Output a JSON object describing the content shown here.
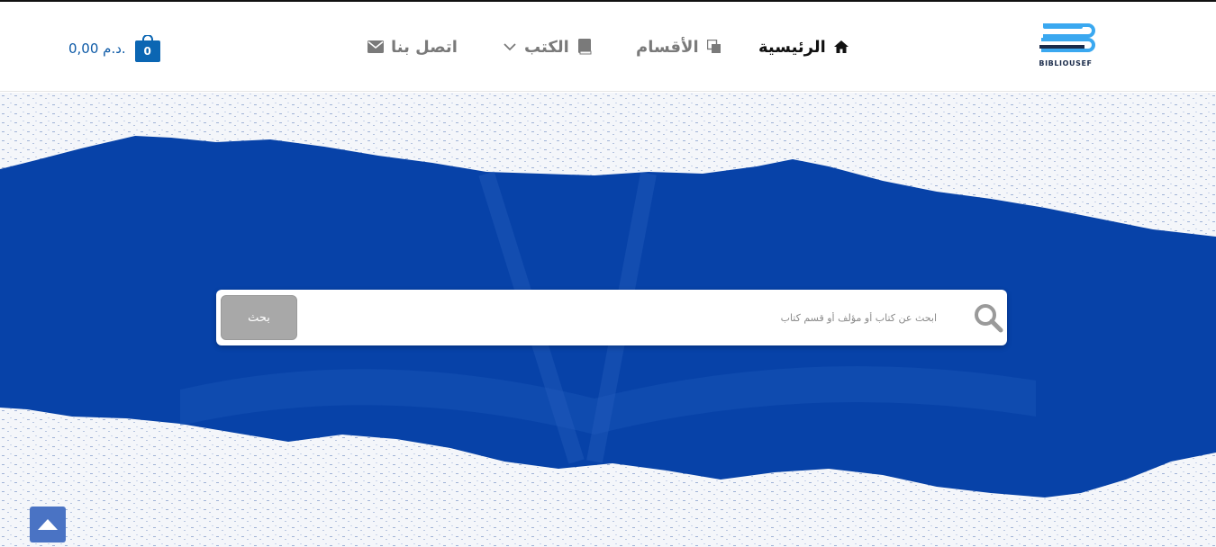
{
  "brand": {
    "logo_text": "BIBLIOUSEF",
    "colors": {
      "logo_blue": "#3aa8f0",
      "logo_dark": "#1a2b4a"
    }
  },
  "nav": {
    "home": {
      "label": "الرئيسية",
      "icon": "home-icon"
    },
    "categories": {
      "label": "الأقسام",
      "icon": "copy-icon"
    },
    "books": {
      "label": "الكتب",
      "icon": "book-icon",
      "dropdown_icon": "chevron-down-icon"
    },
    "contact": {
      "label": "اتصل بنا",
      "icon": "envelope-icon"
    }
  },
  "cart": {
    "count": "0",
    "total": "0,00 د.م.",
    "icon": "shopping-bag-icon",
    "color": "#0b66b3"
  },
  "hero": {
    "colors": {
      "band": "#0742a8",
      "paper": "#f4f6fa"
    }
  },
  "search": {
    "placeholder": "ابحث عن كتاب أو مؤلف أو قسم كتاب",
    "button_label": "بحث",
    "icon": "search-icon"
  },
  "scroll_top": {
    "icon": "chevron-up-icon",
    "color": "#4a73c4"
  }
}
